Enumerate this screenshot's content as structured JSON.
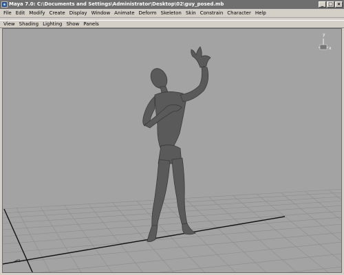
{
  "window": {
    "title": "Maya 7.0: C:\\Documents and Settings\\Administrator\\Desktop\\02\\guy_posed.mb",
    "min_glyph": "_",
    "max_glyph": "□",
    "close_glyph": "×"
  },
  "main_menu": [
    "File",
    "Edit",
    "Modify",
    "Create",
    "Display",
    "Window",
    "Animate",
    "Deform",
    "Skeleton",
    "Skin",
    "Constrain",
    "Character",
    "Help"
  ],
  "panel_menu": [
    "View",
    "Shading",
    "Lighting",
    "Show",
    "Panels"
  ],
  "viewport": {
    "view_cube_axis_label": "y",
    "view_cube_x_label": "x",
    "origin_axis_label": "z",
    "background_color": "#a3a3a3",
    "model_color": "#5a5a5a",
    "grid_color": "#8a8a8a"
  }
}
